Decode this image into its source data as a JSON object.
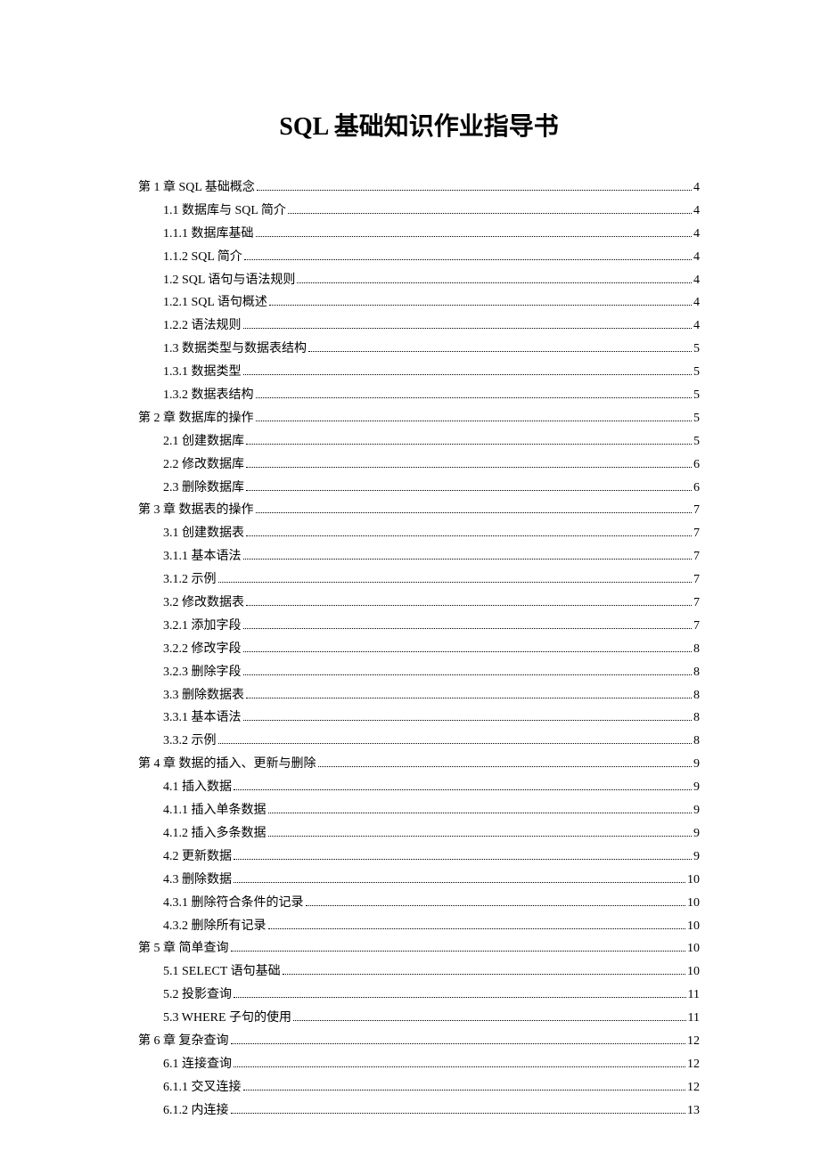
{
  "title": "SQL 基础知识作业指导书",
  "toc": [
    {
      "level": 0,
      "label": "第 1 章 SQL 基础概念",
      "page": "4"
    },
    {
      "level": 1,
      "label": "1.1 数据库与 SQL 简介",
      "page": "4"
    },
    {
      "level": 1,
      "label": "1.1.1 数据库基础",
      "page": "4"
    },
    {
      "level": 1,
      "label": "1.1.2 SQL 简介",
      "page": "4"
    },
    {
      "level": 1,
      "label": "1.2 SQL 语句与语法规则",
      "page": "4"
    },
    {
      "level": 1,
      "label": "1.2.1 SQL 语句概述",
      "page": "4"
    },
    {
      "level": 1,
      "label": "1.2.2 语法规则",
      "page": "4"
    },
    {
      "level": 1,
      "label": "1.3 数据类型与数据表结构",
      "page": "5"
    },
    {
      "level": 1,
      "label": "1.3.1 数据类型",
      "page": "5"
    },
    {
      "level": 1,
      "label": "1.3.2 数据表结构",
      "page": "5"
    },
    {
      "level": 0,
      "label": "第 2 章 数据库的操作",
      "page": "5"
    },
    {
      "level": 1,
      "label": "2.1 创建数据库",
      "page": "5"
    },
    {
      "level": 1,
      "label": "2.2 修改数据库",
      "page": "6"
    },
    {
      "level": 1,
      "label": "2.3 删除数据库",
      "page": "6"
    },
    {
      "level": 0,
      "label": "第 3 章 数据表的操作",
      "page": "7"
    },
    {
      "level": 1,
      "label": "3.1 创建数据表",
      "page": "7"
    },
    {
      "level": 1,
      "label": "3.1.1 基本语法",
      "page": "7"
    },
    {
      "level": 1,
      "label": "3.1.2 示例",
      "page": "7"
    },
    {
      "level": 1,
      "label": "3.2 修改数据表",
      "page": "7"
    },
    {
      "level": 1,
      "label": "3.2.1 添加字段",
      "page": "7"
    },
    {
      "level": 1,
      "label": "3.2.2 修改字段",
      "page": "8"
    },
    {
      "level": 1,
      "label": "3.2.3 删除字段",
      "page": "8"
    },
    {
      "level": 1,
      "label": "3.3 删除数据表",
      "page": "8"
    },
    {
      "level": 1,
      "label": "3.3.1 基本语法",
      "page": "8"
    },
    {
      "level": 1,
      "label": "3.3.2 示例",
      "page": "8"
    },
    {
      "level": 0,
      "label": "第 4 章 数据的插入、更新与删除",
      "page": "9"
    },
    {
      "level": 1,
      "label": "4.1 插入数据",
      "page": "9"
    },
    {
      "level": 1,
      "label": "4.1.1 插入单条数据",
      "page": "9"
    },
    {
      "level": 1,
      "label": "4.1.2 插入多条数据",
      "page": "9"
    },
    {
      "level": 1,
      "label": "4.2 更新数据",
      "page": "9"
    },
    {
      "level": 1,
      "label": "4.3 删除数据",
      "page": "10"
    },
    {
      "level": 1,
      "label": "4.3.1 删除符合条件的记录",
      "page": "10"
    },
    {
      "level": 1,
      "label": "4.3.2 删除所有记录",
      "page": "10"
    },
    {
      "level": 0,
      "label": "第 5 章 简单查询",
      "page": "10"
    },
    {
      "level": 1,
      "label": "5.1 SELECT 语句基础",
      "page": "10"
    },
    {
      "level": 1,
      "label": "5.2 投影查询",
      "page": "11"
    },
    {
      "level": 1,
      "label": "5.3 WHERE 子句的使用",
      "page": "11"
    },
    {
      "level": 0,
      "label": "第 6 章 复杂查询",
      "page": "12"
    },
    {
      "level": 1,
      "label": "6.1 连接查询",
      "page": "12"
    },
    {
      "level": 1,
      "label": "6.1.1 交叉连接",
      "page": "12"
    },
    {
      "level": 1,
      "label": "6.1.2 内连接",
      "page": "13"
    }
  ]
}
